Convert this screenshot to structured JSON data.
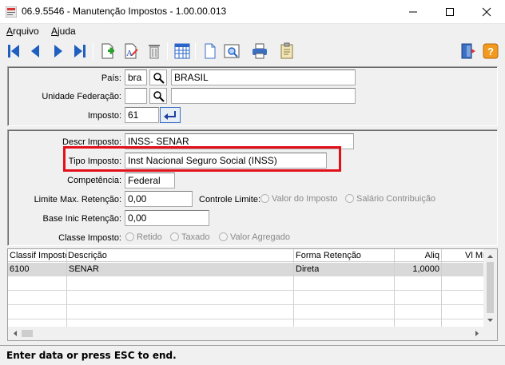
{
  "window": {
    "title": "06.9.5546 - Manutenção Impostos - 1.00.00.013"
  },
  "menu": {
    "arquivo_first": "A",
    "arquivo_rest": "rquivo",
    "ajuda_first": "A",
    "ajuda_rest": "juda"
  },
  "header": {
    "pais_label": "País:",
    "pais_code": "bra",
    "pais_name": "BRASIL",
    "uf_label": "Unidade Federação:",
    "uf_code": "",
    "uf_name": "",
    "imposto_label": "Imposto:",
    "imposto_value": "61"
  },
  "detail": {
    "descr_label": "Descr  Imposto:",
    "descr_value": "INSS- SENAR",
    "tipo_label": "Tipo Imposto:",
    "tipo_value": "Inst Nacional Seguro Social (INSS)",
    "competencia_label": "Competência:",
    "competencia_value": "Federal",
    "limite_label": "Limite Max. Retenção:",
    "limite_value": "0,00",
    "controle_label": "Controle Limite:",
    "controle_opt1": "Valor do Imposto",
    "controle_opt2": "Salário Contribuição",
    "base_label": "Base Inic Retenção:",
    "base_value": "0,00",
    "classe_label": "Classe Imposto:",
    "classe_opt1": "Retido",
    "classe_opt2": "Taxado",
    "classe_opt3": "Valor Agregado"
  },
  "grid": {
    "columns": [
      "Classif Imposto",
      "Descrição",
      "Forma Retenção",
      "Aliq",
      "Vl Min"
    ],
    "rows": [
      {
        "classif": "6100",
        "descricao": "SENAR",
        "forma": "Direta",
        "aliq": "1,0000",
        "vlmin": ""
      }
    ]
  },
  "status": {
    "text": "Enter data or press ESC to end."
  },
  "colors": {
    "highlight": "#e3101a",
    "toolbar_blue": "#1f5fbf",
    "selected_row": "#d9d9d9"
  }
}
